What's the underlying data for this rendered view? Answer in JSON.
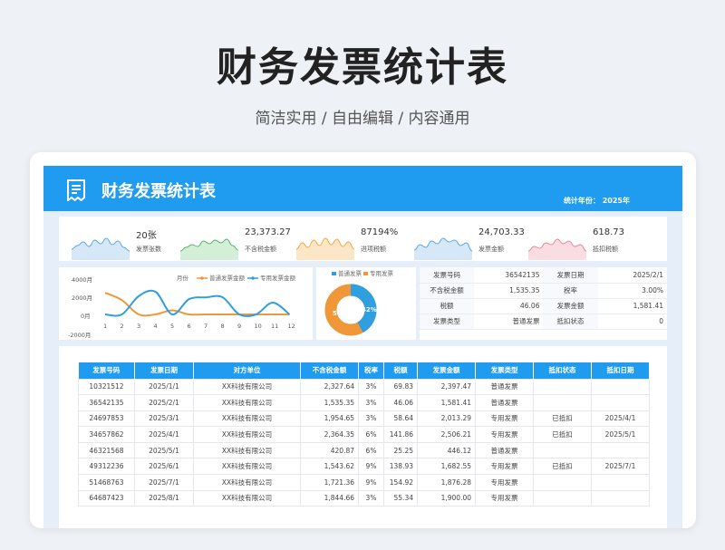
{
  "page": {
    "title": "财务发票统计表",
    "subtitle": "简洁实用 / 自由编辑 / 内容通用"
  },
  "header": {
    "title": "财务发票统计表",
    "year_label": "统计年份：  2025年"
  },
  "kpis": [
    {
      "value": "20张",
      "label": "发票张数",
      "color": "#5ba7e6",
      "fill": "#d6e8f8"
    },
    {
      "value": "23,373.27",
      "label": "不含税金额",
      "color": "#57b56a",
      "fill": "#d4efd8"
    },
    {
      "value": "87194%",
      "label": "进项税额",
      "color": "#f1a73a",
      "fill": "#fbe7c7"
    },
    {
      "value": "24,703.33",
      "label": "发票金额",
      "color": "#5ba7e6",
      "fill": "#d6e8f8"
    },
    {
      "value": "618.73",
      "label": "抵扣税额",
      "color": "#e98596",
      "fill": "#f9dde2"
    }
  ],
  "line_chart": {
    "legend_month": "月份",
    "series_names": [
      "普通发票金额",
      "专用发票金额"
    ],
    "colors": [
      "#f0973a",
      "#2f9fe0"
    ],
    "yticks": [
      "4000月",
      "2000月",
      "0月",
      "-2000月"
    ],
    "xticks": [
      "1",
      "2",
      "3",
      "4",
      "5",
      "6",
      "7",
      "8",
      "9",
      "10",
      "11",
      "12"
    ]
  },
  "donut": {
    "legend": [
      "普通发票",
      "专用发票"
    ],
    "colors": [
      "#2f9fe0",
      "#f0973a"
    ],
    "labels": [
      "42%",
      "58%"
    ]
  },
  "info": {
    "rows": [
      [
        "发票号码",
        "36542135",
        "发票日期",
        "2025/2/1"
      ],
      [
        "不含税金额",
        "1,535.35",
        "税率",
        "3.00%"
      ],
      [
        "税额",
        "46.06",
        "发票金额",
        "1,581.41"
      ],
      [
        "发票类型",
        "普通发票",
        "抵扣状态",
        "0"
      ]
    ]
  },
  "table": {
    "headers": [
      "发票号码",
      "发票日期",
      "对方单位",
      "不含税金额",
      "税率",
      "税额",
      "发票金额",
      "发票类型",
      "抵扣状态",
      "抵扣日期"
    ],
    "rows": [
      [
        "10321512",
        "2025/1/1",
        "XX科技有限公司",
        "2,327.64",
        "3%",
        "69.83",
        "2,397.47",
        "普通发票",
        "",
        ""
      ],
      [
        "36542135",
        "2025/2/1",
        "XX科技有限公司",
        "1,535.35",
        "3%",
        "46.06",
        "1,581.41",
        "普通发票",
        "",
        ""
      ],
      [
        "24697853",
        "2025/3/1",
        "XX科技有限公司",
        "1,954.65",
        "3%",
        "58.64",
        "2,013.29",
        "专用发票",
        "已抵扣",
        "2025/4/1"
      ],
      [
        "34657862",
        "2025/4/1",
        "XX科技有限公司",
        "2,364.35",
        "6%",
        "141.86",
        "2,506.21",
        "专用发票",
        "已抵扣",
        "2025/5/1"
      ],
      [
        "46321568",
        "2025/5/1",
        "XX科技有限公司",
        "420.87",
        "6%",
        "25.25",
        "446.12",
        "普通发票",
        "",
        ""
      ],
      [
        "49312236",
        "2025/6/1",
        "XX科技有限公司",
        "1,543.62",
        "9%",
        "138.93",
        "1,682.55",
        "专用发票",
        "已抵扣",
        "2025/7/1"
      ],
      [
        "51468763",
        "2025/7/1",
        "XX科技有限公司",
        "1,721.36",
        "9%",
        "154.92",
        "1,876.28",
        "专用发票",
        "",
        ""
      ],
      [
        "64687423",
        "2025/8/1",
        "XX科技有限公司",
        "1,844.66",
        "3%",
        "55.34",
        "1,900.00",
        "专用发票",
        "",
        ""
      ]
    ]
  }
}
